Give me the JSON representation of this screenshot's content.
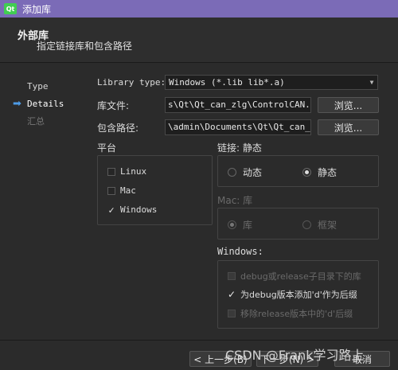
{
  "window": {
    "title": "添加库"
  },
  "header": {
    "title": "外部库",
    "subtitle": "指定链接库和包含路径"
  },
  "steps": [
    {
      "label": "Type"
    },
    {
      "label": "Details"
    },
    {
      "label": "汇总"
    }
  ],
  "form": {
    "library_type_label": "Library type:",
    "library_type_value": "Windows (*.lib lib*.a)",
    "library_file_label": "库文件:",
    "library_file_value": "s\\Qt\\Qt_can_zlg\\ControlCAN.lib",
    "include_path_label": "包含路径:",
    "include_path_value": "\\admin\\Documents\\Qt\\Qt_can_zlg",
    "browse_label": "浏览..."
  },
  "platform": {
    "title": "平台",
    "options": [
      {
        "label": "Linux",
        "checked": false
      },
      {
        "label": "Mac",
        "checked": false
      },
      {
        "label": "Windows",
        "checked": true
      }
    ]
  },
  "linkage": {
    "title": "链接: 静态",
    "dynamic_label": "动态",
    "static_label": "静态",
    "selected": "静态"
  },
  "mac": {
    "title": "Mac: 库",
    "library_label": "库",
    "framework_label": "框架",
    "selected": "库"
  },
  "windows": {
    "title": "Windows:",
    "options": [
      {
        "label": "debug或release子目录下的库",
        "checked": false
      },
      {
        "label": "为debug版本添加'd'作为后缀",
        "checked": true
      },
      {
        "label": "移除release版本中的'd'后缀",
        "checked": false
      }
    ]
  },
  "footer": {
    "back_label": "< 上一步(B)",
    "next_label": "下一步(N) >",
    "cancel_label": "取消"
  },
  "watermark": "CSDN @Frank学习路上"
}
